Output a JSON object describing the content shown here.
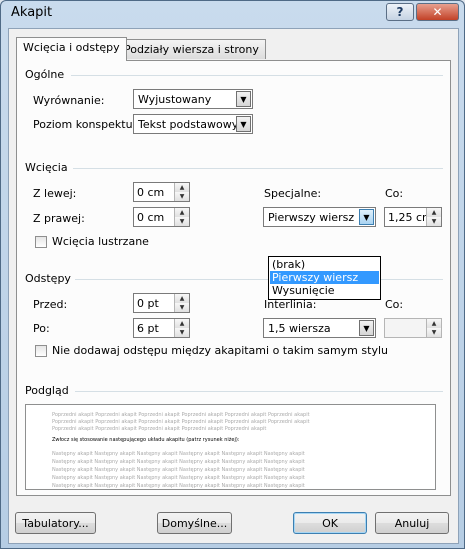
{
  "window": {
    "title": "Akapit",
    "help_glyph": "?",
    "close_glyph": "✕"
  },
  "tabs": [
    {
      "label": "Wcięcia i odstępy",
      "active": true
    },
    {
      "label": "Podziały wiersza i strony",
      "active": false
    }
  ],
  "general": {
    "heading": "Ogólne",
    "alignment_label": "Wyrównanie:",
    "alignment_value": "Wyjustowany",
    "outline_label": "Poziom konspektu:",
    "outline_value": "Tekst podstawowy"
  },
  "indentation": {
    "heading": "Wcięcia",
    "left_label": "Z lewej:",
    "left_value": "0 cm",
    "right_label": "Z prawej:",
    "right_value": "0 cm",
    "special_label": "Specjalne:",
    "special_value": "Pierwszy wiersz",
    "by_label": "Co:",
    "by_value": "1,25 cm",
    "mirror_label": "Wcięcia lustrzane",
    "mirror_checked": false,
    "special_options": [
      "(brak)",
      "Pierwszy wiersz",
      "Wysunięcie"
    ],
    "special_selected": "Pierwszy wiersz"
  },
  "spacing": {
    "heading": "Odstępy",
    "before_label": "Przed:",
    "before_value": "0 pt",
    "after_label": "Po:",
    "after_value": "6 pt",
    "line_label": "Interlinia:",
    "line_value": "1,5 wiersza",
    "at_label": "Co:",
    "at_value": "",
    "no_space_label": "Nie dodawaj odstępu między akapitami o takim samym stylu",
    "no_space_checked": false
  },
  "preview": {
    "heading": "Podgląd",
    "prev_text_1": "Poprzedni akapit Poprzedni akapit Poprzedni akapit Poprzedni akapit Poprzedni akapit Poprzedni akapit",
    "prev_text_2": "Poprzedni akapit Poprzedni akapit Poprzedni akapit Poprzedni akapit Poprzedni akapit",
    "current_text": "Zwłocz się stosowanie następującego układu akapitu (patrz rysunek niżej):",
    "next_text": "Następny akapit Następny akapit Następny akapit Następny akapit Następny akapit Następny akapit"
  },
  "buttons": {
    "tabs": "Tabulatory...",
    "default": "Domyślne...",
    "ok": "OK",
    "cancel": "Anuluj"
  },
  "icons": {
    "dropdown_arrow": "▼",
    "spin_up": "▲",
    "spin_down": "▼"
  }
}
